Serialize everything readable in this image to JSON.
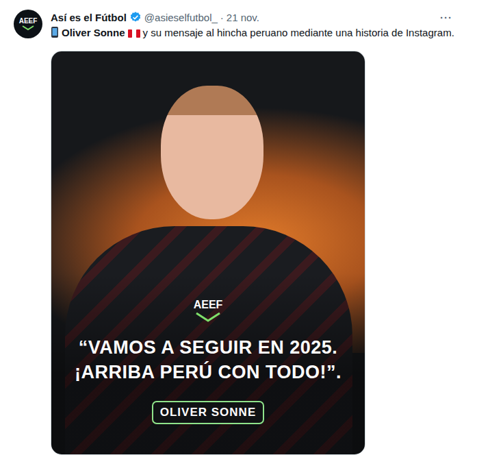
{
  "post": {
    "avatar_text": "AEEF",
    "author": "Así es el Fútbol",
    "verified": true,
    "handle": "@asieselfutbol_",
    "separator": "·",
    "date": "21 nov.",
    "more": "···",
    "text_bold": "Oliver Sonne",
    "text": "y su mensaje al hincha peruano mediante una historia de Instagram."
  },
  "media": {
    "watermark": "AEEF",
    "quote": "“VAMOS A SEGUIR EN 2025. ¡ARRIBA PERÚ CON TODO!”.",
    "name_label": "OLIVER SONNE"
  }
}
